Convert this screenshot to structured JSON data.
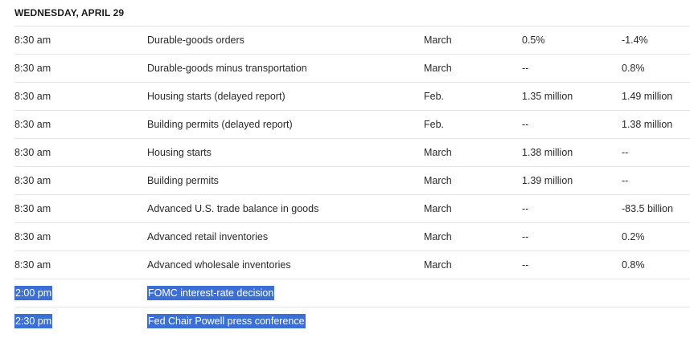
{
  "header": {
    "day": "WEDNESDAY, APRIL 29"
  },
  "rows": [
    {
      "time": "8:30 am",
      "report": "Durable-goods orders",
      "period": "March",
      "forecast": "0.5%",
      "previous": "-1.4%"
    },
    {
      "time": "8:30 am",
      "report": "Durable-goods minus transportation",
      "period": "March",
      "forecast": "--",
      "previous": "0.8%"
    },
    {
      "time": "8:30 am",
      "report": "Housing starts (delayed report)",
      "period": "Feb.",
      "forecast": "1.35 million",
      "previous": "1.49 million"
    },
    {
      "time": "8:30 am",
      "report": "Building permits (delayed report)",
      "period": "Feb.",
      "forecast": "--",
      "previous": "1.38 million"
    },
    {
      "time": "8:30 am",
      "report": "Housing starts",
      "period": "March",
      "forecast": "1.38 million",
      "previous": "--"
    },
    {
      "time": "8:30 am",
      "report": "Building permits",
      "period": "March",
      "forecast": "1.39 million",
      "previous": "--"
    },
    {
      "time": "8:30 am",
      "report": "Advanced U.S. trade balance in goods",
      "period": "March",
      "forecast": "--",
      "previous": "-83.5 billion"
    },
    {
      "time": "8:30 am",
      "report": "Advanced retail inventories",
      "period": "March",
      "forecast": "--",
      "previous": "0.2%"
    },
    {
      "time": "8:30 am",
      "report": "Advanced wholesale inventories",
      "period": "March",
      "forecast": "--",
      "previous": "0.8%"
    },
    {
      "time": "2:00 pm",
      "report": "FOMC interest-rate decision",
      "period": "",
      "forecast": "",
      "previous": ""
    },
    {
      "time": "2:30 pm",
      "report": "Fed Chair Powell press conference",
      "period": "",
      "forecast": "",
      "previous": ""
    }
  ],
  "colors": {
    "selection": "#3b6fd6",
    "row_divider": "#e3e3e3"
  }
}
